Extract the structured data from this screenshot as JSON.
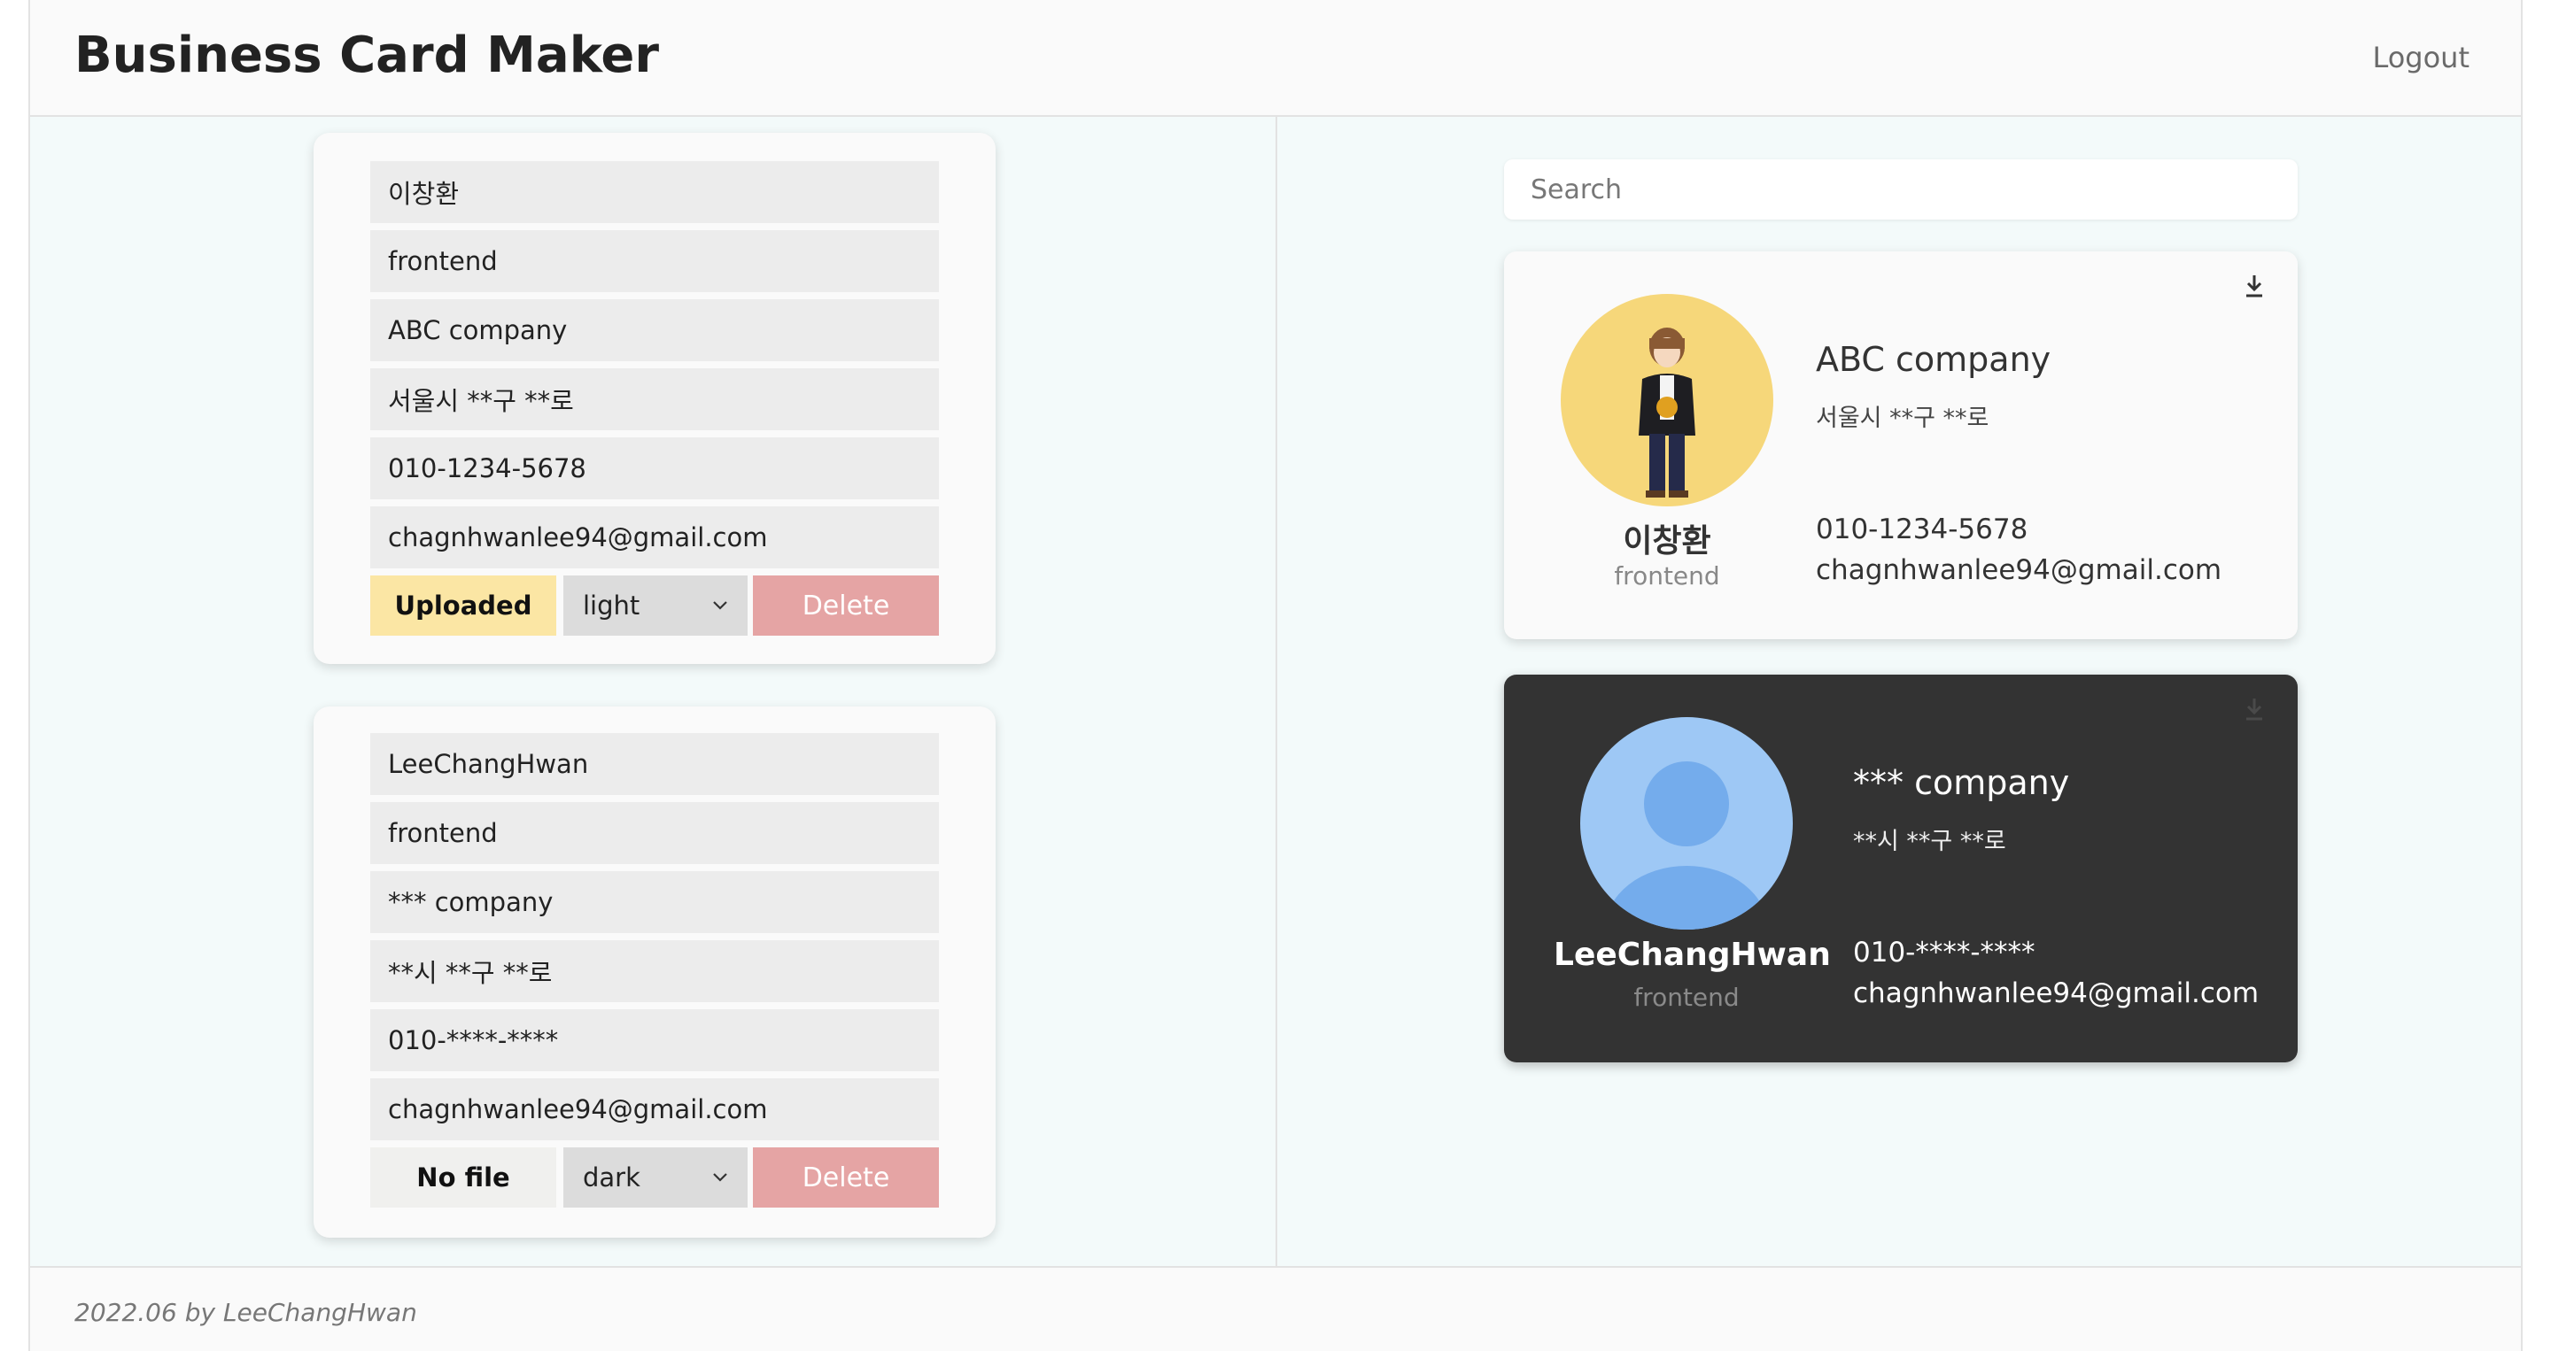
{
  "header": {
    "title": "Business Card Maker",
    "logout_label": "Logout"
  },
  "editor": {
    "cards": [
      {
        "name": "이창환",
        "title": "frontend",
        "company": "ABC company",
        "address": "서울시 **구 **로",
        "phone": "010-1234-5678",
        "email": "chagnhwanlee94@gmail.com",
        "file_label": "Uploaded",
        "theme": "light",
        "delete_label": "Delete"
      },
      {
        "name": "LeeChangHwan",
        "title": "frontend",
        "company": "*** company",
        "address": "**시 **구 **로",
        "phone": "010-****-****",
        "email": "chagnhwanlee94@gmail.com",
        "file_label": "No file",
        "theme": "dark",
        "delete_label": "Delete"
      }
    ]
  },
  "preview": {
    "search_placeholder": "Search",
    "cards": [
      {
        "name": "이창환",
        "title": "frontend",
        "company": "ABC company",
        "address": "서울시 **구 **로",
        "phone": "010-1234-5678",
        "email": "chagnhwanlee94@gmail.com",
        "theme": "light",
        "avatar": "person-illustration"
      },
      {
        "name": "LeeChangHwan",
        "title": "frontend",
        "company": "*** company",
        "address": "**시 **구 **로",
        "phone": "010-****-****",
        "email": "chagnhwanlee94@gmail.com",
        "theme": "dark",
        "avatar": "default-user-icon"
      }
    ]
  },
  "footer": {
    "text": "2022.06 by LeeChangHwan"
  },
  "colors": {
    "uploaded_button": "#fbe6a4",
    "delete_button": "#e5a4a4",
    "avatar_light_bg": "#f6d77a",
    "avatar_default_bg": "#9ec8f5",
    "dark_card_bg": "#333333"
  }
}
